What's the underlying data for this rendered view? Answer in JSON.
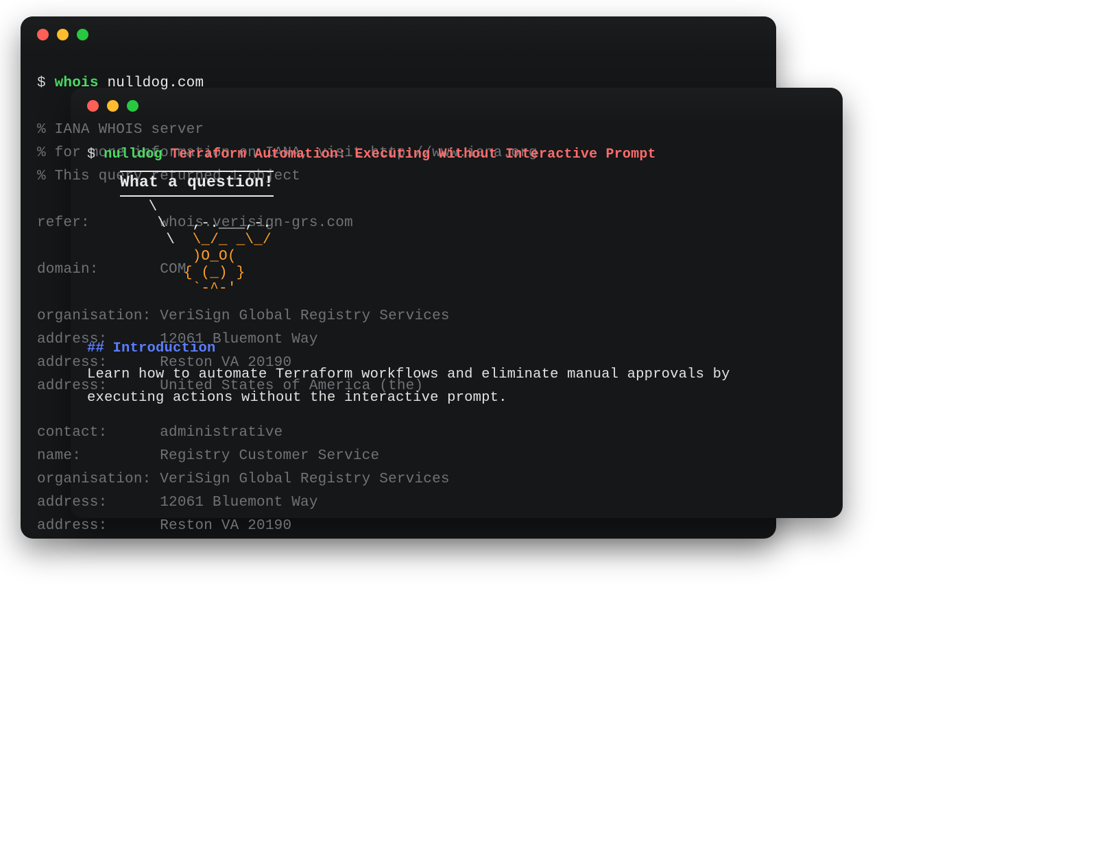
{
  "back": {
    "prompt": "$",
    "command": "whois",
    "argument": "nulldog.com",
    "lines": [
      "% IANA WHOIS server",
      "% for more information on IANA, visit http://www.iana.org",
      "% This query returned 1 object",
      "",
      "refer:        whois.verisign-grs.com",
      "",
      "domain:       COM",
      "",
      "organisation: VeriSign Global Registry Services",
      "address:      12061 Bluemont Way",
      "address:      Reston VA 20190",
      "address:      United States of America (the)",
      "",
      "contact:      administrative",
      "name:         Registry Customer Service",
      "organisation: VeriSign Global Registry Services",
      "address:      12061 Bluemont Way",
      "address:      Reston VA 20190"
    ]
  },
  "front": {
    "prompt": "$",
    "command": "nulldog",
    "headline": "Terraform Automation: Executing Without Interactive Prompt",
    "box_text": "What a question!",
    "ascii": {
      "l1": "       \\",
      "l2": "        \\   ,-.___,-.",
      "l3": "         \\  \\_/_ _\\_/",
      "l4": "            )O_O(",
      "l5": "           { (_) }",
      "l6": "            `-^-'"
    },
    "section_heading": "## Introduction",
    "section_body": "Learn how to automate Terraform workflows and eliminate manual approvals by executing actions without the interactive prompt."
  }
}
